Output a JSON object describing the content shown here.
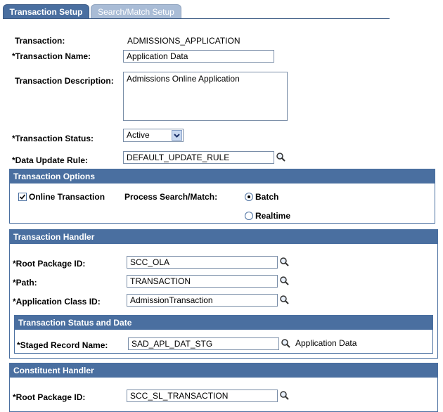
{
  "tabs": [
    {
      "label": "Transaction Setup",
      "active": true
    },
    {
      "label": "Search/Match Setup",
      "active": false
    }
  ],
  "form": {
    "transaction_label": "Transaction:",
    "transaction_value": "ADMISSIONS_APPLICATION",
    "name_label": "*Transaction Name:",
    "name_value": "Application Data",
    "description_label": "Transaction Description:",
    "description_value": "Admissions Online Application",
    "status_label": "*Transaction Status:",
    "status_value": "Active",
    "update_rule_label": "*Data Update Rule:",
    "update_rule_value": "DEFAULT_UPDATE_RULE"
  },
  "options": {
    "header": "Transaction Options",
    "online_label": "Online Transaction",
    "online_checked": true,
    "process_label": "Process Search/Match:",
    "batch_label": "Batch",
    "realtime_label": "Realtime",
    "selected": "Batch"
  },
  "handler": {
    "header": "Transaction Handler",
    "root_label": "*Root Package ID:",
    "root_value": "SCC_OLA",
    "path_label": "*Path:",
    "path_value": "TRANSACTION",
    "class_label": "*Application Class ID:",
    "class_value": "AdmissionTransaction",
    "status_date": {
      "header": "Transaction Status and Date",
      "staged_label": "*Staged Record Name:",
      "staged_value": "SAD_APL_DAT_STG",
      "staged_desc": "Application Data"
    }
  },
  "constituent": {
    "header": "Constituent Handler",
    "root_label": "*Root Package ID:",
    "root_value": "SCC_SL_TRANSACTION"
  },
  "colors": {
    "accent": "#4a6fa0",
    "tab_inactive": "#a9bcd6"
  }
}
